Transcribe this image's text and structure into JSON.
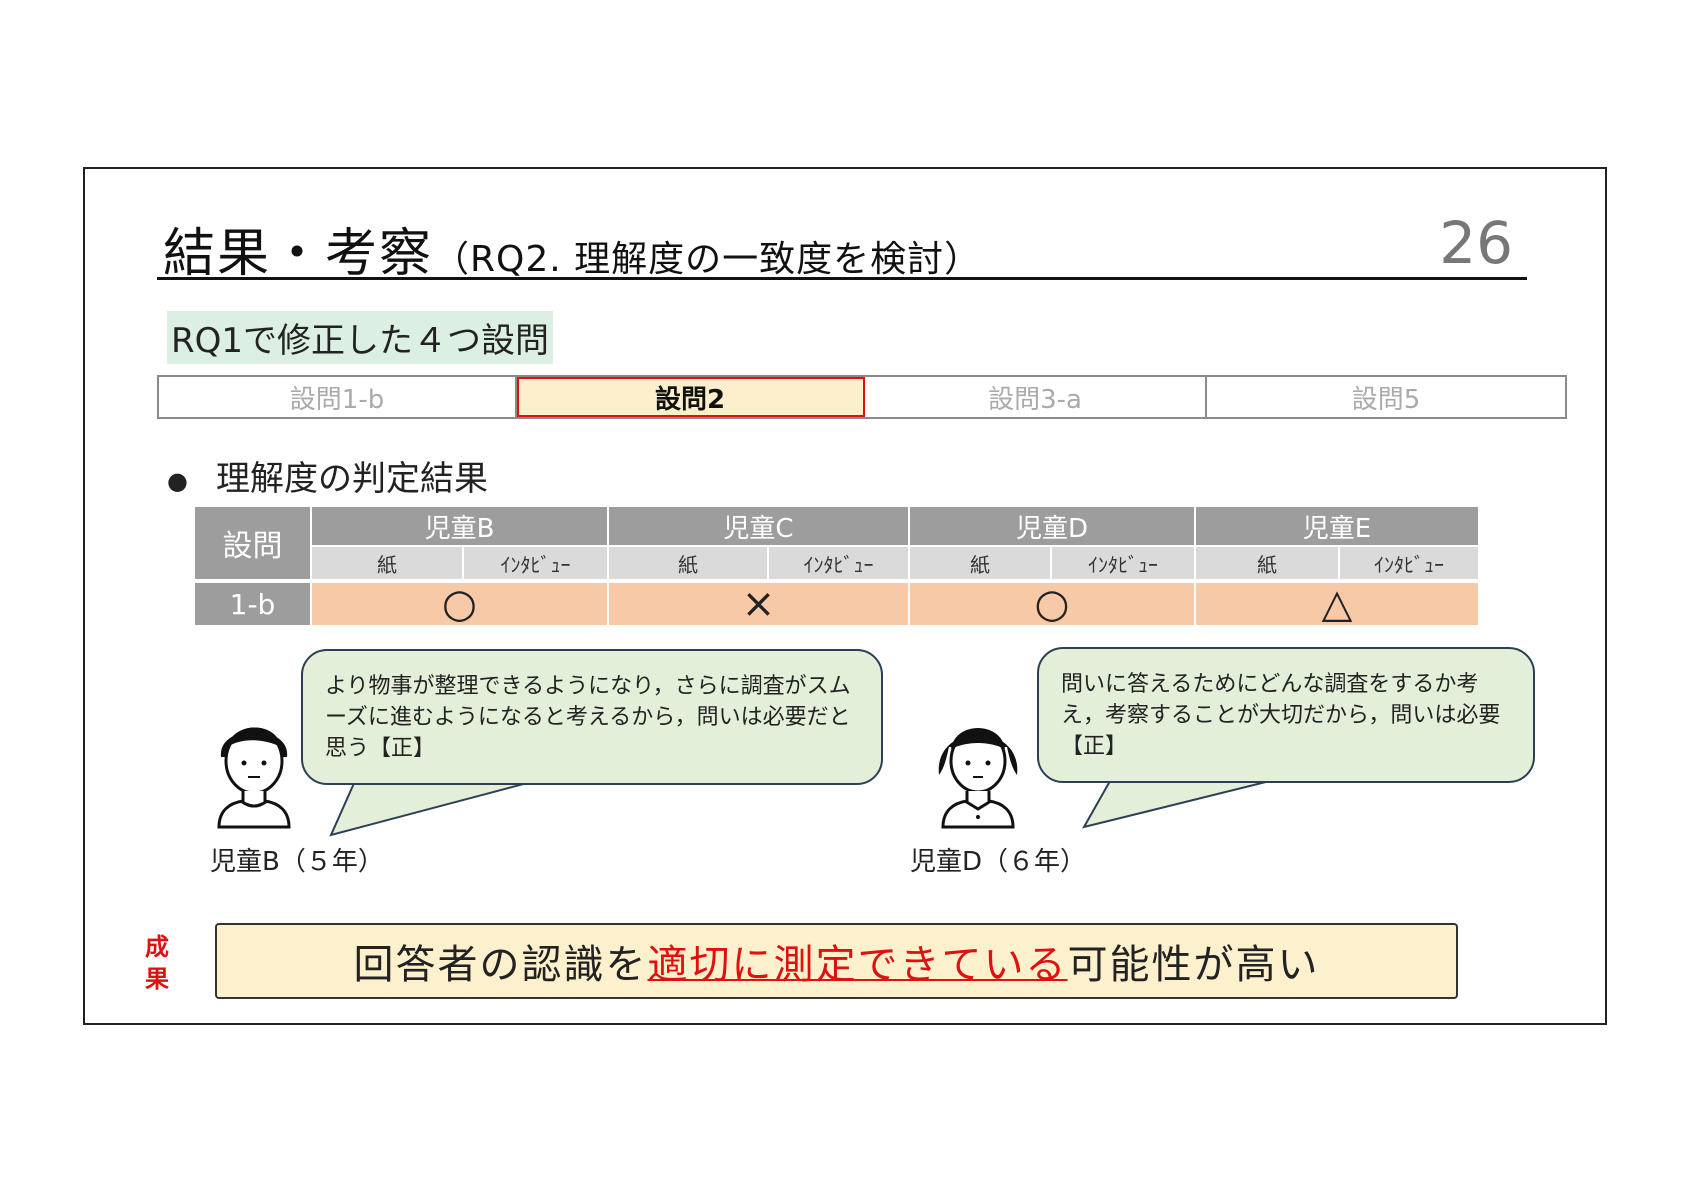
{
  "slide": {
    "title_main": "結果・考察",
    "title_sub": "（RQ2. 理解度の一致度を検討）",
    "page_number": "26",
    "rq_label": "RQ1で修正した４つ設問"
  },
  "tabs": [
    {
      "label": "設問1-b",
      "active": false
    },
    {
      "label": "設問2",
      "active": true
    },
    {
      "label": "設問3-a",
      "active": false
    },
    {
      "label": "設問5",
      "active": false
    }
  ],
  "bullet": "理解度の判定結果",
  "judgement_table": {
    "question_header": "設問",
    "children": [
      "児童B",
      "児童C",
      "児童D",
      "児童E"
    ],
    "sub_headers": [
      "紙",
      "ｲﾝﾀﾋﾞｭｰ"
    ],
    "rows": [
      {
        "label": "1-b",
        "marks": [
          "○",
          "×",
          "○",
          "△"
        ]
      }
    ]
  },
  "comments": [
    {
      "text": "より物事が整理できるようになり，さらに調査がスムーズに進むようになると考えるから，問いは必要だと思う【正】",
      "speaker": "児童B（５年）"
    },
    {
      "text": "問いに答えるためにどんな調査をするか考え，考察することが大切だから，問いは必要【正】",
      "speaker": "児童D（６年）"
    }
  ],
  "result": {
    "tag_line1": "成",
    "tag_line2": "果",
    "text_before": "回答者の認識を",
    "text_highlight": "適切に測定できている",
    "text_after": "可能性が高い"
  },
  "colors": {
    "active_tab_fill": "#fdefcc",
    "active_tab_border": "#e01010",
    "table_header": "#9d9d9d",
    "table_row_fill": "#f7c9a7",
    "bubble_fill": "#e4efd9",
    "result_fill": "#fdf0cc",
    "highlight_text": "#e01010"
  }
}
